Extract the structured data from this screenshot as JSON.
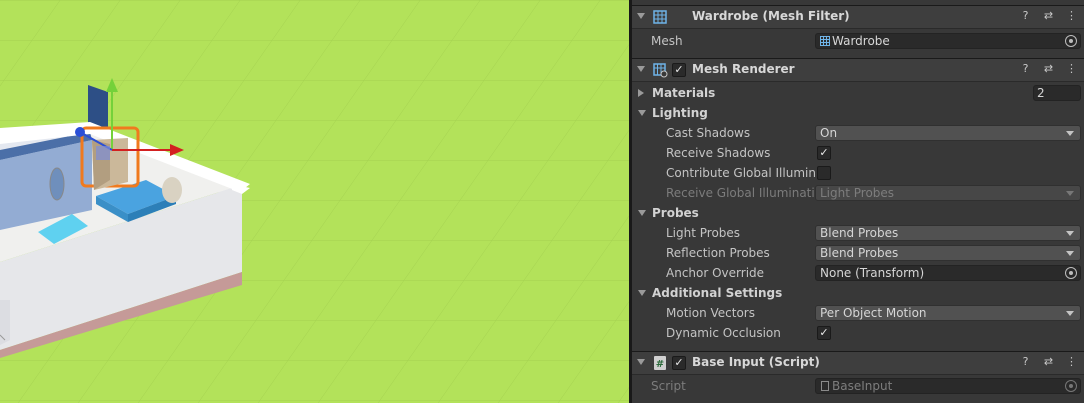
{
  "scene": {
    "background": "#b3e25a"
  },
  "components": {
    "mesh_filter": {
      "title": "Wardrobe (Mesh Filter)",
      "mesh_label": "Mesh",
      "mesh_value": "Wardrobe"
    },
    "mesh_renderer": {
      "title": "Mesh Renderer",
      "enabled": true,
      "materials_label": "Materials",
      "materials_count": "2",
      "lighting_label": "Lighting",
      "cast_shadows_label": "Cast Shadows",
      "cast_shadows_value": "On",
      "receive_shadows_label": "Receive Shadows",
      "receive_shadows_checked": true,
      "contribute_gi_label": "Contribute Global Illuminat",
      "contribute_gi_checked": false,
      "receive_gi_label": "Receive Global Illumination",
      "receive_gi_value": "Light Probes",
      "probes_label": "Probes",
      "light_probes_label": "Light Probes",
      "light_probes_value": "Blend Probes",
      "reflection_probes_label": "Reflection Probes",
      "reflection_probes_value": "Blend Probes",
      "anchor_override_label": "Anchor Override",
      "anchor_override_value": "None (Transform)",
      "additional_settings_label": "Additional Settings",
      "motion_vectors_label": "Motion Vectors",
      "motion_vectors_value": "Per Object Motion",
      "dynamic_occlusion_label": "Dynamic Occlusion",
      "dynamic_occlusion_checked": true
    },
    "base_input": {
      "title": "Base Input (Script)",
      "enabled": true,
      "script_label": "Script",
      "script_value": "BaseInput"
    }
  },
  "icons": {
    "help": "help-icon",
    "presets": "presets-icon",
    "menu": "kebab-menu-icon",
    "checkmark": "✓",
    "hash": "#"
  },
  "colors": {
    "inspector_bg": "#383838",
    "header_bg": "#3e3e3e",
    "field_bg": "#2a2a2a",
    "dropdown_bg": "#515151"
  }
}
